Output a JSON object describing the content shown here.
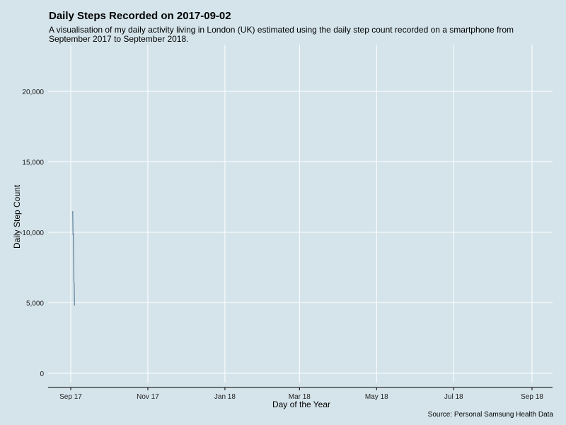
{
  "chart_data": {
    "type": "line",
    "title": "Daily Steps Recorded on 2017-09-02",
    "subtitle": "A visualisation of my daily activity living in London (UK) estimated using the daily step count recorded on a smartphone from September 2017 to September 2018.",
    "caption": "Source: Personal Samsung Health Data",
    "xlabel": "Day of the Year",
    "ylabel": "Daily Step Count",
    "x_ticks": [
      "Sep 17",
      "Nov 17",
      "Jan 18",
      "Mar 18",
      "May 18",
      "Jul 18",
      "Sep 18"
    ],
    "y_ticks": [
      "0",
      "5,000",
      "10,000",
      "15,000",
      "20,000"
    ],
    "ylim": [
      -1000,
      23000
    ],
    "grid": true,
    "line_color": "#4a6e8a",
    "series": [
      {
        "x": [
          "2017-09-02",
          "2017-09-02",
          "2017-09-02",
          "2017-09-02",
          "2017-09-02",
          "2017-09-02",
          "2017-09-02"
        ],
        "values": [
          11500,
          9800,
          9900,
          8000,
          6500,
          6400,
          4800
        ]
      }
    ]
  }
}
